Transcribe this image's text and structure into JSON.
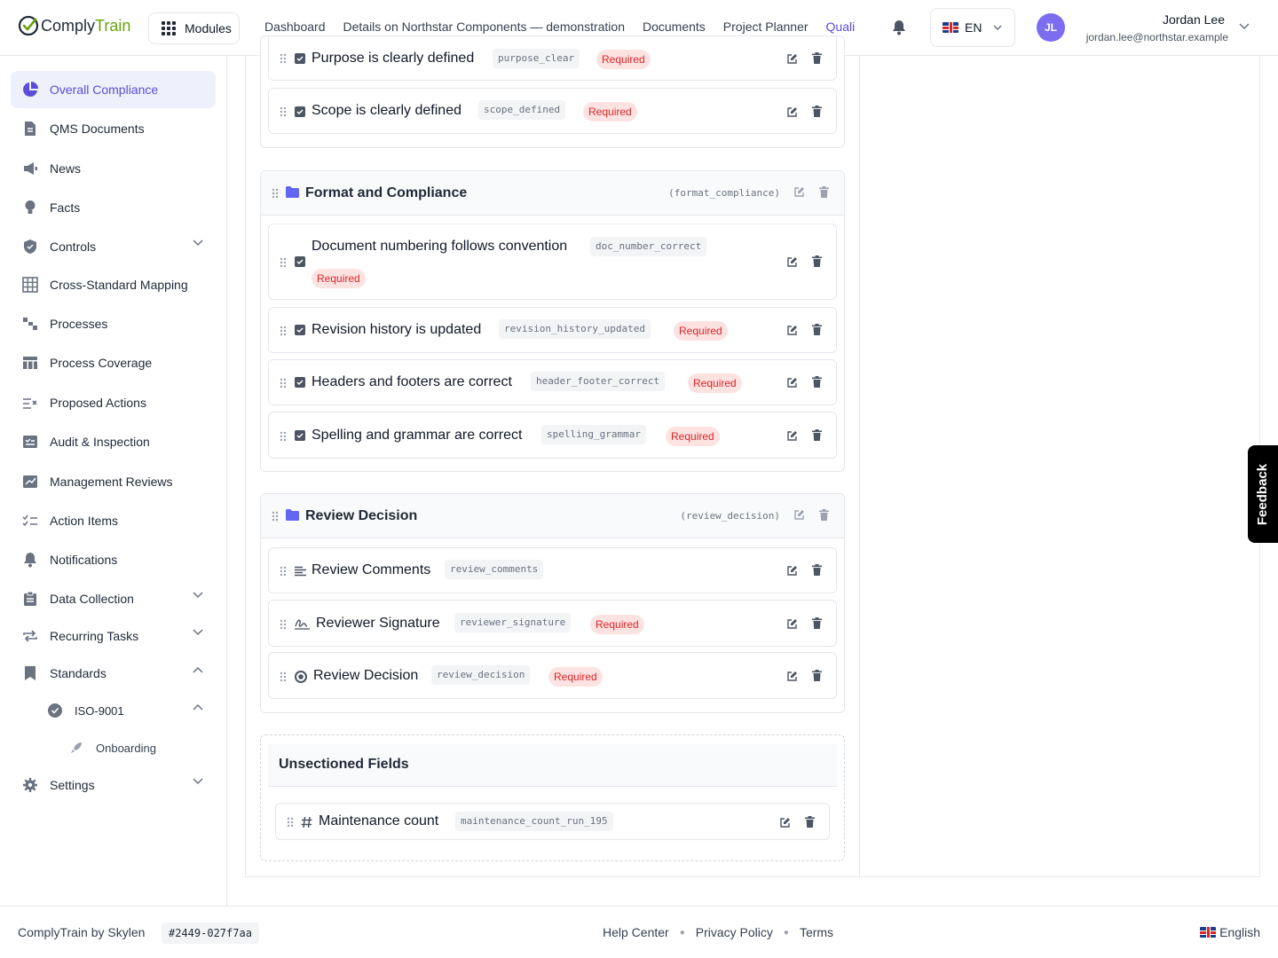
{
  "header": {
    "logo_part1": "Comply",
    "logo_part2": "Train",
    "modules_label": "Modules",
    "nav": [
      "Dashboard",
      "Details on Northstar Components — demonstration",
      "Documents",
      "Project Planner",
      "Quali"
    ],
    "lang_label": "EN",
    "avatar_initials": "JL",
    "user_name": "Jordan Lee",
    "user_email": "jordan.lee@northstar.example"
  },
  "sidebar": {
    "items": [
      {
        "label": "Overall Compliance",
        "icon": "pie-chart-icon"
      },
      {
        "label": "QMS Documents",
        "icon": "document-icon"
      },
      {
        "label": "News",
        "icon": "megaphone-icon"
      },
      {
        "label": "Facts",
        "icon": "lightbulb-icon"
      },
      {
        "label": "Controls",
        "icon": "shield-icon"
      },
      {
        "label": "Cross-Standard Mapping",
        "icon": "table-grid-icon"
      },
      {
        "label": "Processes",
        "icon": "flow-icon"
      },
      {
        "label": "Process Coverage",
        "icon": "coverage-table-icon"
      },
      {
        "label": "Proposed Actions",
        "icon": "list-check-icon"
      },
      {
        "label": "Audit & Inspection",
        "icon": "audit-icon"
      },
      {
        "label": "Management Reviews",
        "icon": "review-chart-icon"
      },
      {
        "label": "Action Items",
        "icon": "checklist-icon"
      },
      {
        "label": "Notifications",
        "icon": "bell-icon"
      },
      {
        "label": "Data Collection",
        "icon": "clipboard-icon"
      },
      {
        "label": "Recurring Tasks",
        "icon": "repeat-icon"
      },
      {
        "label": "Standards",
        "icon": "bookmark-icon"
      },
      {
        "label": "ISO-9001",
        "icon": "badge-check-icon"
      },
      {
        "label": "Onboarding",
        "icon": "rocket-icon"
      },
      {
        "label": "Settings",
        "icon": "gear-icon"
      }
    ]
  },
  "sections": [
    {
      "title": "",
      "fields": [
        {
          "label": "Purpose is clearly defined",
          "key": "purpose_clear",
          "required": "Required"
        },
        {
          "label": "Scope is clearly defined",
          "key": "scope_defined",
          "required": "Required"
        }
      ]
    },
    {
      "title": "Format and Compliance",
      "key": "(format_compliance)",
      "fields": [
        {
          "label": "Document numbering follows convention",
          "key": "doc_number_correct",
          "required": "Required"
        },
        {
          "label": "Revision history is updated",
          "key": "revision_history_updated",
          "required": "Required"
        },
        {
          "label": "Headers and footers are correct",
          "key": "header_footer_correct",
          "required": "Required"
        },
        {
          "label": "Spelling and grammar are correct",
          "key": "spelling_grammar",
          "required": "Required"
        }
      ]
    },
    {
      "title": "Review Decision",
      "key": "(review_decision)",
      "fields": [
        {
          "label": "Review Comments",
          "key": "review_comments"
        },
        {
          "label": "Reviewer Signature",
          "key": "reviewer_signature",
          "required": "Required"
        },
        {
          "label": "Review Decision",
          "key": "review_decision",
          "required": "Required"
        }
      ]
    }
  ],
  "unsectioned": {
    "title": "Unsectioned Fields",
    "fields": [
      {
        "label": "Maintenance count",
        "key": "maintenance_count_run_195"
      }
    ]
  },
  "feedback_label": "Feedback",
  "footer": {
    "brand": "ComplyTrain by Skylen",
    "build": "#2449-027f7aa",
    "links": [
      "Help Center",
      "Privacy Policy",
      "Terms"
    ],
    "language": "English"
  },
  "colors": {
    "accent": "#5b4dd8",
    "required_bg": "#fde2e2",
    "required_text": "#dc2626",
    "logo_green": "#65a30d"
  }
}
